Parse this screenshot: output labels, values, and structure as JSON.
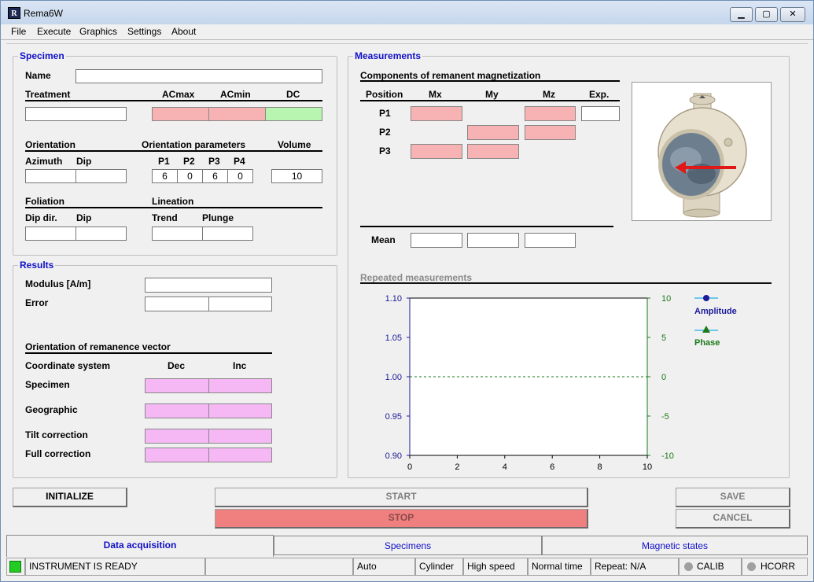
{
  "window": {
    "title": "Rema6W",
    "icon_letter": "R",
    "buttons": {
      "minimize": "▁",
      "maximize": "▢",
      "close": "✕"
    }
  },
  "menu": [
    "File",
    "Execute",
    "Graphics",
    "Settings",
    "About"
  ],
  "specimen": {
    "title": "Specimen",
    "name_label": "Name",
    "name_value": "",
    "treatment_label": "Treatment",
    "acmax_label": "ACmax",
    "acmin_label": "ACmin",
    "dc_label": "DC",
    "orientation_label": "Orientation",
    "orientation_params_label": "Orientation parameters",
    "volume_label": "Volume",
    "azimuth_label": "Azimuth",
    "dip_label": "Dip",
    "p_labels": [
      "P1",
      "P2",
      "P3",
      "P4"
    ],
    "p_values": [
      "6",
      "0",
      "6",
      "0"
    ],
    "volume_value": "10",
    "foliation_label": "Foliation",
    "lineation_label": "Lineation",
    "dipdir_label": "Dip dir.",
    "dip2_label": "Dip",
    "trend_label": "Trend",
    "plunge_label": "Plunge"
  },
  "results": {
    "title": "Results",
    "modulus_label": "Modulus [A/m]",
    "error_label": "Error",
    "orientation_title": "Orientation of remanence vector",
    "coord_label": "Coordinate system",
    "dec_label": "Dec",
    "inc_label": "Inc",
    "rows": [
      "Specimen",
      "Geographic",
      "Tilt correction",
      "Full correction"
    ]
  },
  "measurements": {
    "title": "Measurements",
    "components_title": "Components of remanent magnetization",
    "headers": [
      "Position",
      "Mx",
      "My",
      "Mz",
      "Exp."
    ],
    "rows": [
      "P1",
      "P2",
      "P3"
    ],
    "mean_label": "Mean",
    "repeated_title": "Repeated measurements"
  },
  "chart_data": {
    "type": "line",
    "title": "Repeated measurements",
    "xlim": [
      0,
      10
    ],
    "x_ticks": [
      "0",
      "2",
      "4",
      "6",
      "8",
      "10"
    ],
    "y_left_lim": [
      0.9,
      1.1
    ],
    "y_left_ticks": [
      "1.10",
      "1.05",
      "1.00",
      "0.95",
      "0.90"
    ],
    "y_right_lim": [
      -10,
      10
    ],
    "y_right_ticks": [
      "10",
      "5",
      "0",
      "-5",
      "-10"
    ],
    "series": [
      {
        "name": "Amplitude",
        "color": "#1a1a9a",
        "marker": "circle",
        "values": []
      },
      {
        "name": "Phase",
        "color": "#1a7a1a",
        "marker": "triangle",
        "values": []
      }
    ],
    "reference_line": 0,
    "legend_position": "right"
  },
  "buttons": {
    "initialize": "INITIALIZE",
    "start": "START",
    "stop": "STOP",
    "save": "SAVE",
    "cancel": "CANCEL"
  },
  "tabs": [
    "Data acquisition",
    "Specimens",
    "Magnetic states"
  ],
  "status": {
    "message": "INSTRUMENT IS READY",
    "empty": "",
    "mode": "Auto",
    "geometry": "Cylinder",
    "speed": "High speed",
    "time": "Normal time",
    "repeat": "Repeat: N/A",
    "calib": "CALIB",
    "hcorr": "HCORR",
    "ready_color": "#22cc22",
    "indicator_color": "#a0a0a0"
  },
  "colors": {
    "pink": "#f7b3b3",
    "green": "#b7f5b0",
    "magenta": "#f5b8f5",
    "stop": "#f08080",
    "group_title": "#1010c8"
  }
}
